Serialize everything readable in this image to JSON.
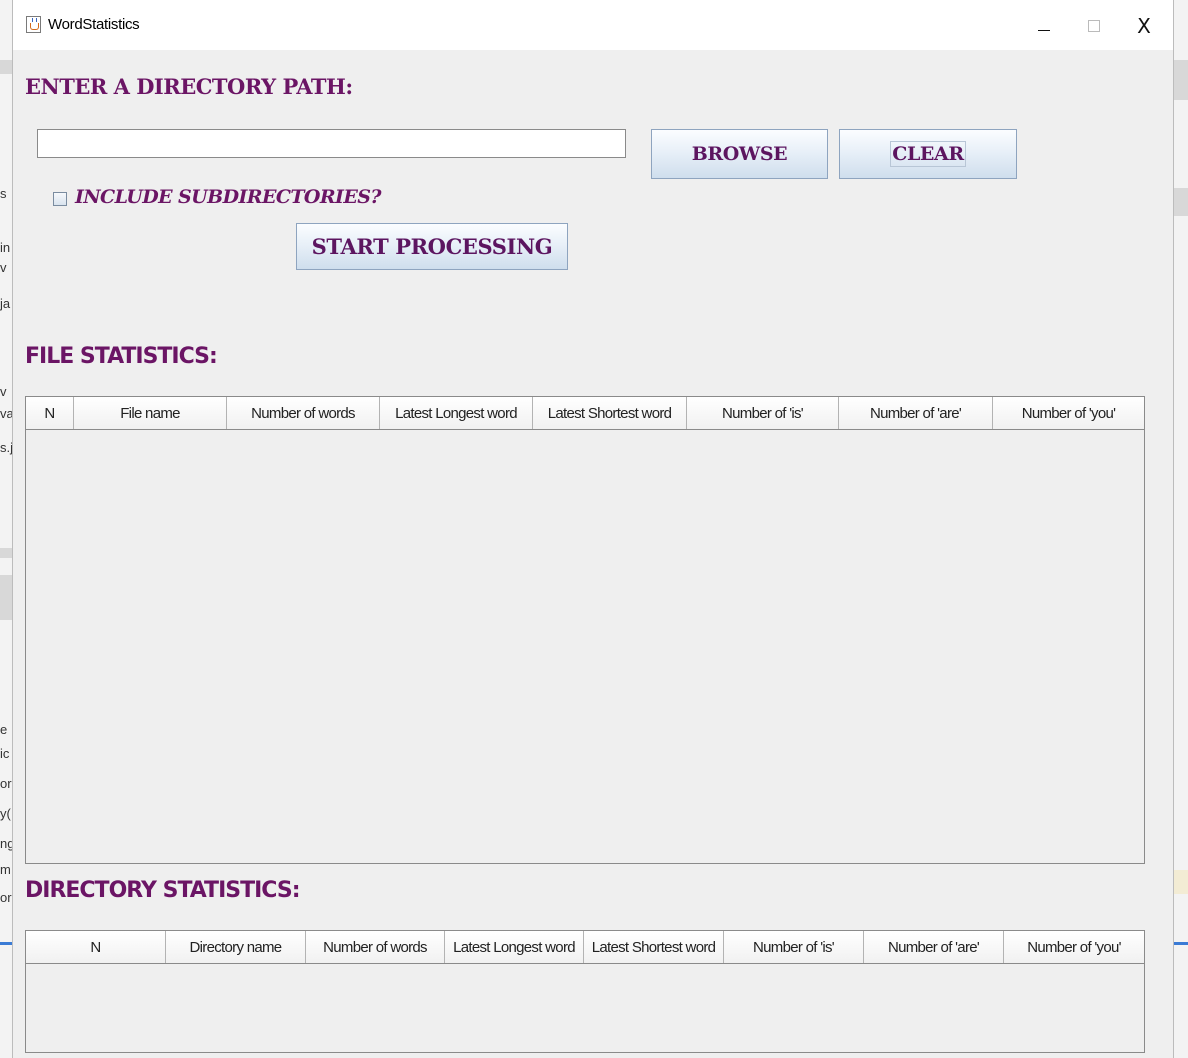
{
  "window": {
    "title": "WordStatistics",
    "controls": {
      "minimize": "–",
      "maximize": "□",
      "close": "X"
    }
  },
  "directory": {
    "label": "ENTER A DIRECTORY PATH:",
    "path_value": "",
    "browse_label": "BROWSE",
    "clear_label": "CLEAR",
    "include_subdirs_label": "INCLUDE SUBDIRECTORIES?",
    "include_subdirs_checked": false,
    "start_label": "START PROCESSING"
  },
  "file_stats": {
    "heading": "FILE STATISTICS:",
    "columns": [
      "N",
      "File name",
      "Number of words",
      "Latest Longest word",
      "Latest Shortest word",
      "Number of 'is'",
      "Number of 'are'",
      "Number of 'you'"
    ],
    "rows": []
  },
  "dir_stats": {
    "heading": "DIRECTORY STATISTICS:",
    "columns": [
      "N",
      "Directory name",
      "Number of words",
      "Latest Longest word",
      "Latest Shortest word",
      "Number of 'is'",
      "Number of 'are'",
      "Number of 'you'"
    ],
    "rows": []
  },
  "background_fragments": [
    "s",
    "in",
    "v",
    "ja",
    "v",
    "va",
    "s.j",
    "e",
    "ic",
    "or",
    "y(",
    "ng",
    "m",
    "or"
  ],
  "colors": {
    "label_purple": "#6b1565",
    "window_bg": "#efefef",
    "button_gradient_bottom": "#cfdeed"
  }
}
